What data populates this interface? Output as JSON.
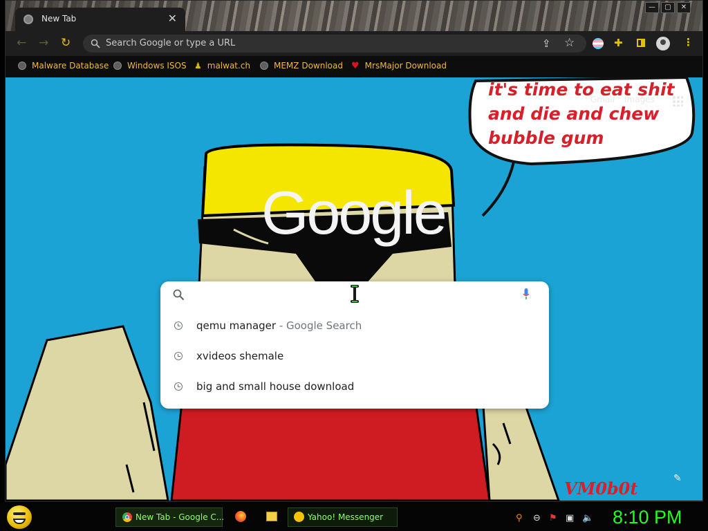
{
  "window": {
    "tab_title": "New Tab",
    "tab_close": "✕",
    "controls": {
      "minimize": "—",
      "maximize": "▢",
      "close": "✕"
    }
  },
  "toolbar": {
    "back": "←",
    "forward": "→",
    "reload": "↻",
    "omnibox_placeholder": "Search Google or type a URL",
    "star": "☆",
    "share": "⇪",
    "kebab": "⋮"
  },
  "bookmarks": [
    {
      "label": "Malware Database",
      "icon": "globe-icon"
    },
    {
      "label": "Windows ISOS",
      "icon": "globe-icon"
    },
    {
      "label": "malwat.ch",
      "icon": "figure-icon"
    },
    {
      "label": "MEMZ Download",
      "icon": "globe-icon"
    },
    {
      "label": "MrsMajor Download",
      "icon": "heart-icon"
    }
  ],
  "page": {
    "speech_lines": [
      "it's time to eat shit",
      "and die and chew",
      "bubble gum"
    ],
    "gmail": "Gmail",
    "images": "Images",
    "logo": "Google",
    "signature": "VM0b0t"
  },
  "search": {
    "value": "",
    "suggestions": [
      {
        "text": "qemu manager",
        "suffix": " - Google Search"
      },
      {
        "text": "xvideos shemale",
        "suffix": ""
      },
      {
        "text": "big and small house download",
        "suffix": ""
      }
    ]
  },
  "taskbar": {
    "chrome_task": "New Tab - Google C...",
    "yahoo_task": "Yahoo! Messenger",
    "clock": "8:10 PM"
  },
  "colors": {
    "page_bg": "#1ca3d6",
    "accent_yellow": "#e0c200",
    "bookmark_text": "#f0b840",
    "speech_red": "#d8202a",
    "clock_green": "#22ff22"
  }
}
